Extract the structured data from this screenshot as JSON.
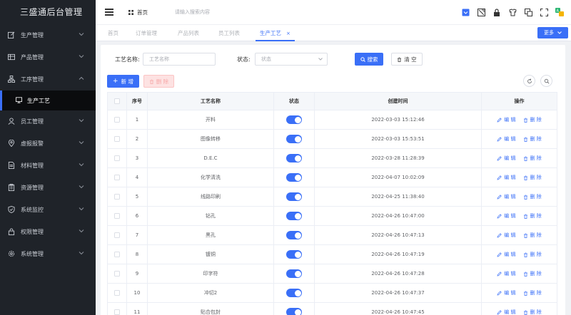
{
  "app": {
    "title": "三盛通后台管理"
  },
  "sidebar": {
    "items": [
      {
        "label": "生产管理",
        "icon": "edit-icon",
        "expanded": false
      },
      {
        "label": "产品管理",
        "icon": "table-icon",
        "expanded": false
      },
      {
        "label": "工序管理",
        "icon": "sitemap-icon",
        "expanded": true,
        "children": [
          {
            "label": "生产工艺",
            "icon": "monitor-icon",
            "active": true
          }
        ]
      },
      {
        "label": "员工管理",
        "icon": "user-icon",
        "expanded": false
      },
      {
        "label": "虚报报警",
        "icon": "location-icon",
        "expanded": false
      },
      {
        "label": "材料管理",
        "icon": "document-icon",
        "expanded": false
      },
      {
        "label": "资源管理",
        "icon": "clipboard-icon",
        "expanded": false
      },
      {
        "label": "系统监控",
        "icon": "shield-icon",
        "expanded": false
      },
      {
        "label": "权限管理",
        "icon": "lock-icon",
        "expanded": false
      },
      {
        "label": "系统管理",
        "icon": "gear-icon",
        "expanded": false
      }
    ]
  },
  "header": {
    "home_label": "首页",
    "search_placeholder": "请输入搜索内容"
  },
  "tabs": [
    {
      "label": "首页",
      "active": false
    },
    {
      "label": "订单管理",
      "active": false
    },
    {
      "label": "产品列表",
      "active": false
    },
    {
      "label": "员工列表",
      "active": false
    },
    {
      "label": "生产工艺",
      "active": true,
      "close": "×"
    }
  ],
  "more_button": "更多",
  "filters": {
    "name_label": "工艺名称:",
    "name_placeholder": "工艺名称",
    "status_label": "状态:",
    "status_placeholder": "状态",
    "search_button": "搜索",
    "reset_button": "清 空"
  },
  "toolbar": {
    "add_button": "新 增",
    "delete_button": "删 除"
  },
  "table": {
    "columns": [
      "序号",
      "工艺名称",
      "状态",
      "创建时间",
      "操作"
    ],
    "edit_label": "编 辑",
    "delete_label": "删 除",
    "rows": [
      {
        "no": "1",
        "name": "开料",
        "status": true,
        "created": "2022-03-03 15:12:46"
      },
      {
        "no": "2",
        "name": "图像转移",
        "status": true,
        "created": "2022-03-03 15:53:51"
      },
      {
        "no": "3",
        "name": "D.E.C",
        "status": true,
        "created": "2022-03-28 11:28:39"
      },
      {
        "no": "4",
        "name": "化学清洗",
        "status": true,
        "created": "2022-04-07 10:02:09"
      },
      {
        "no": "5",
        "name": "线路印刷",
        "status": true,
        "created": "2022-04-25 11:38:40"
      },
      {
        "no": "6",
        "name": "钻孔",
        "status": true,
        "created": "2022-04-26 10:47:00"
      },
      {
        "no": "7",
        "name": "黑孔",
        "status": true,
        "created": "2022-04-26 10:47:13"
      },
      {
        "no": "8",
        "name": "镀铜",
        "status": true,
        "created": "2022-04-26 10:47:19"
      },
      {
        "no": "9",
        "name": "印字符",
        "status": true,
        "created": "2022-04-26 10:47:28"
      },
      {
        "no": "10",
        "name": "冲切2",
        "status": true,
        "created": "2022-04-26 10:47:37"
      },
      {
        "no": "11",
        "name": "贴合包封",
        "status": true,
        "created": "2022-04-26 10:47:45"
      }
    ]
  },
  "colors": {
    "accent": "#3a6ff7",
    "sidebar_bg": "#1f2329"
  }
}
